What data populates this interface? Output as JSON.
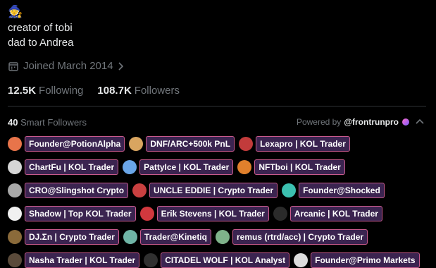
{
  "profile": {
    "emoji": "🧙",
    "bio_lines": [
      "creator of tobi",
      "dad to Andrea"
    ],
    "joined": "Joined March 2014",
    "following_count": "12.5K",
    "following_label": "Following",
    "followers_count": "108.7K",
    "followers_label": "Followers"
  },
  "smart_followers": {
    "count": "40",
    "label": "Smart Followers",
    "powered_by": "Powered by",
    "handle": "@frontrunpro",
    "rows": [
      [
        {
          "label": "Founder@PotionAlpha",
          "avatar": "#e8744a"
        },
        {
          "label": "DNF/ARC+500k PnL",
          "avatar": "#d9a560"
        },
        {
          "label": "Lexapro | KOL Trader",
          "avatar": "#c23b3b"
        }
      ],
      [
        {
          "label": "ChartFu | KOL Trader",
          "avatar": "#d6d6d6"
        },
        {
          "label": "PattyIce | KOL Trader",
          "avatar": "#6aa6e8"
        },
        {
          "label": "NFTboi | KOL Trader",
          "avatar": "#e0802c"
        }
      ],
      [
        {
          "label": "CRO@Slingshot Crypto",
          "avatar": "#a8a8a8"
        },
        {
          "label": "UNCLE EDDIE | Crypto Trader",
          "avatar": "#c94040"
        },
        {
          "label": "Founder@Shocked",
          "avatar": "#3cc0b0"
        }
      ],
      [
        {
          "label": "Shadow | Top KOL Trader",
          "avatar": "#f0f0f0"
        },
        {
          "label": "Erik Stevens | KOL Trader",
          "avatar": "#d1383e"
        },
        {
          "label": "Arcanic | KOL Trader",
          "avatar": "#2a2a2a"
        }
      ],
      [
        {
          "label": "DJ.Σn | Crypto Trader",
          "avatar": "#8a6a3a"
        },
        {
          "label": "Trader@Kinetiq",
          "avatar": "#6fb5a6"
        },
        {
          "label": "remus (rtrd/acc) | Crypto Trader",
          "avatar": "#7fb28a"
        }
      ],
      [
        {
          "label": "Nasha Trader | KOL Trader",
          "avatar": "#5a4a3a"
        },
        {
          "label": "CITADEL WOLF | KOL Analyst",
          "avatar": "#303030"
        },
        {
          "label": "Founder@Primo Markets",
          "avatar": "#dcdcdc"
        }
      ]
    ]
  }
}
